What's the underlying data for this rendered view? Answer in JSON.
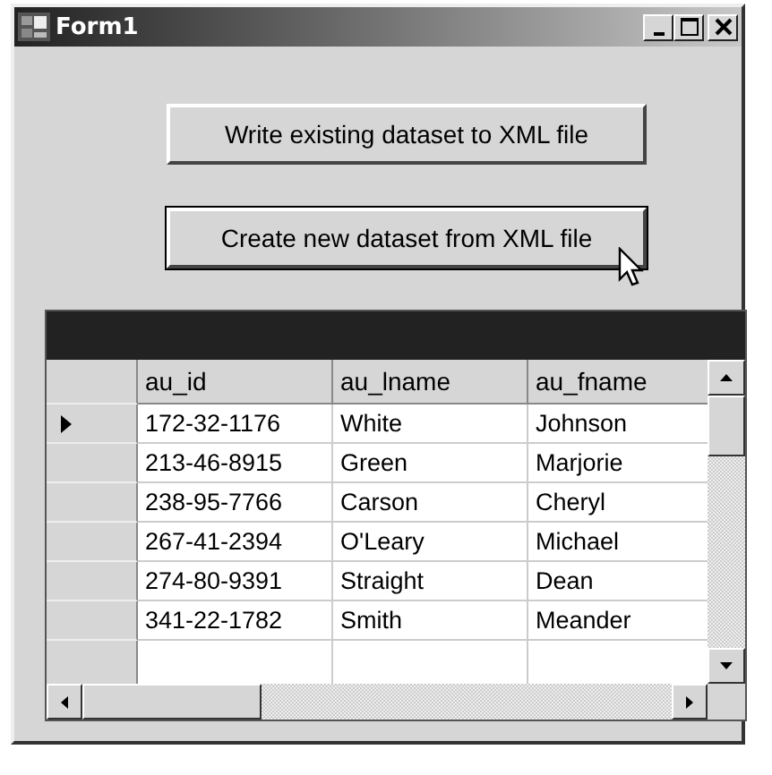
{
  "window": {
    "title": "Form1",
    "controls": [
      {
        "kind": "minimize"
      },
      {
        "kind": "maximize"
      },
      {
        "kind": "close"
      }
    ]
  },
  "buttons": [
    {
      "label": "Write existing dataset to XML file",
      "focused": false
    },
    {
      "label": "Create new dataset from XML file",
      "focused": true
    }
  ],
  "grid": {
    "columns": [
      "au_id",
      "au_lname",
      "au_fname"
    ],
    "rows": [
      {
        "selected": true,
        "cells": [
          "172-32-1176",
          "White",
          "Johnson"
        ]
      },
      {
        "selected": false,
        "cells": [
          "213-46-8915",
          "Green",
          "Marjorie"
        ]
      },
      {
        "selected": false,
        "cells": [
          "238-95-7766",
          "Carson",
          "Cheryl"
        ]
      },
      {
        "selected": false,
        "cells": [
          "267-41-2394",
          "O'Leary",
          "Michael"
        ]
      },
      {
        "selected": false,
        "cells": [
          "274-80-9391",
          "Straight",
          "Dean"
        ]
      },
      {
        "selected": false,
        "cells": [
          "341-22-1782",
          "Smith",
          "Meander"
        ]
      }
    ]
  }
}
